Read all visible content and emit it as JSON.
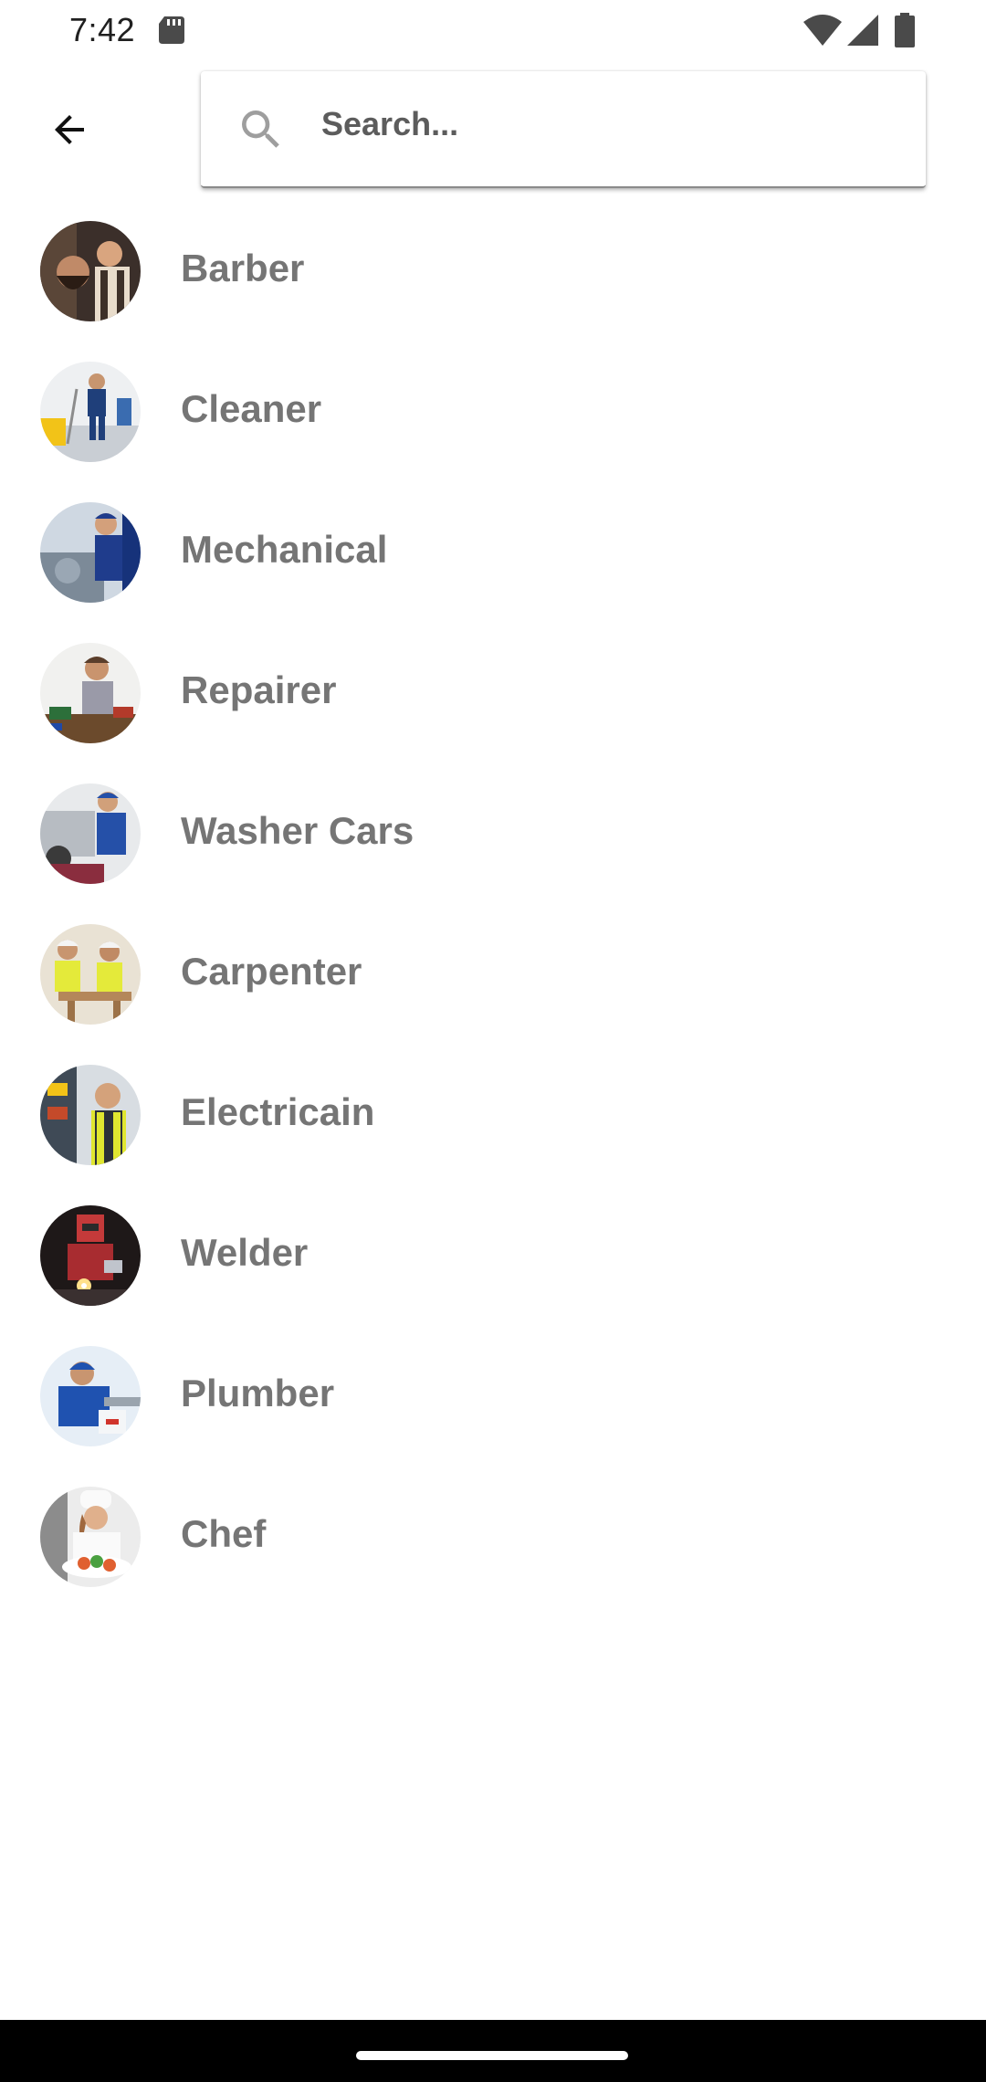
{
  "status_bar": {
    "time": "7:42",
    "icons": [
      "sd-card-icon",
      "wifi-icon",
      "signal-icon",
      "battery-icon"
    ]
  },
  "header": {
    "back_icon": "arrow-back-icon",
    "search": {
      "icon": "search-icon",
      "placeholder": "Search...",
      "value": ""
    }
  },
  "categories": [
    {
      "label": "Barber",
      "avatar": "barber-photo"
    },
    {
      "label": "Cleaner",
      "avatar": "cleaner-photo"
    },
    {
      "label": "Mechanical",
      "avatar": "mechanic-photo"
    },
    {
      "label": "Repairer",
      "avatar": "repairer-photo"
    },
    {
      "label": "Washer Cars",
      "avatar": "car-washer-photo"
    },
    {
      "label": "Carpenter",
      "avatar": "carpenter-photo"
    },
    {
      "label": "Electricain",
      "avatar": "electrician-photo"
    },
    {
      "label": "Welder",
      "avatar": "welder-photo"
    },
    {
      "label": "Plumber",
      "avatar": "plumber-photo"
    },
    {
      "label": "Chef",
      "avatar": "chef-photo"
    }
  ],
  "colors": {
    "label_text": "#757575",
    "background": "#ffffff",
    "nav_bar": "#000000"
  }
}
